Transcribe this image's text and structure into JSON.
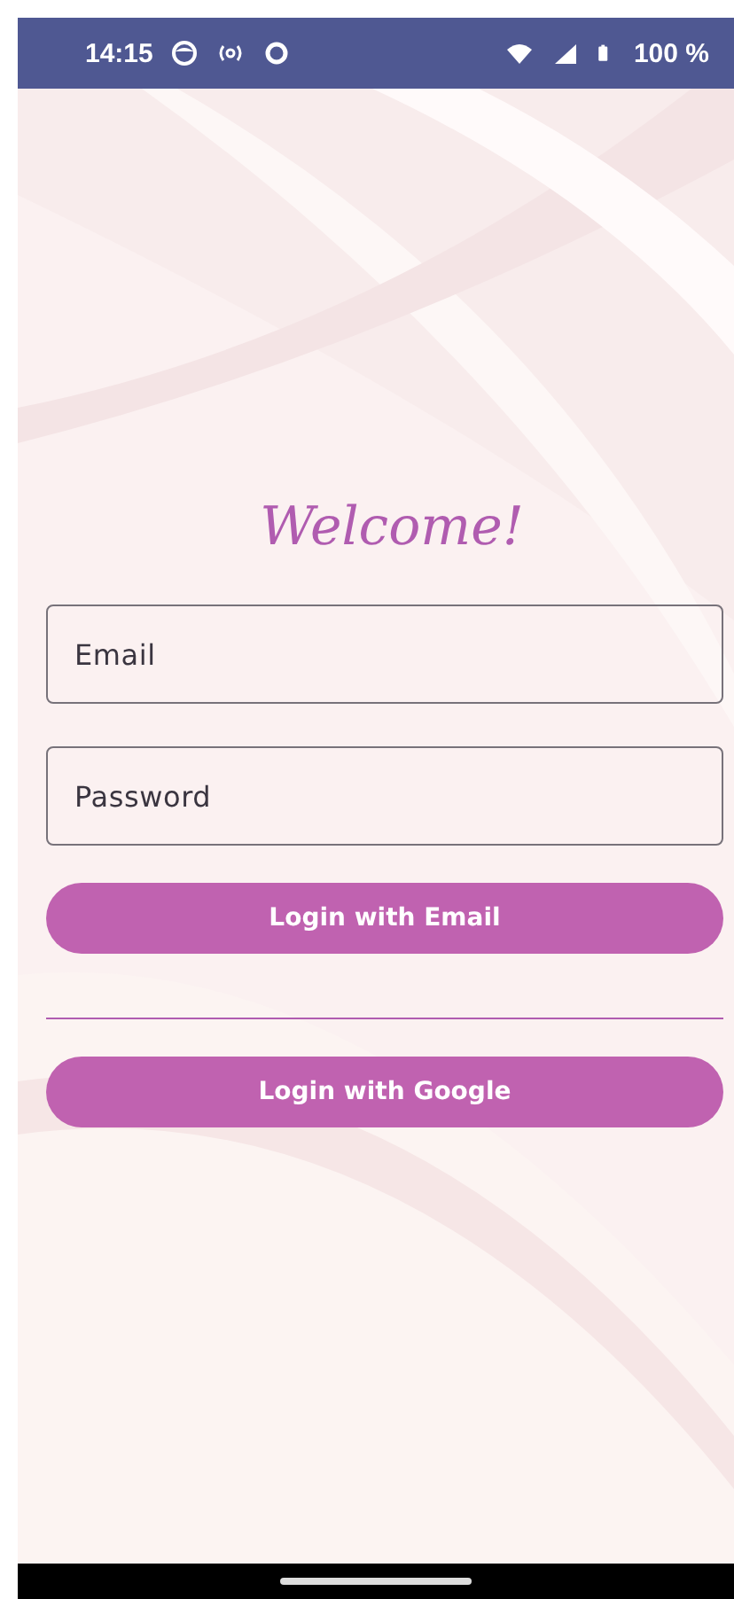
{
  "status_bar": {
    "time": "14:15",
    "battery": "100 %"
  },
  "title": "Welcome!",
  "fields": [
    {
      "placeholder": "Email"
    },
    {
      "placeholder": "Password"
    }
  ],
  "buttons": [
    {
      "label": "Login with Email",
      "kind": "email"
    },
    {
      "label": "Login with Google",
      "kind": "google"
    }
  ]
}
